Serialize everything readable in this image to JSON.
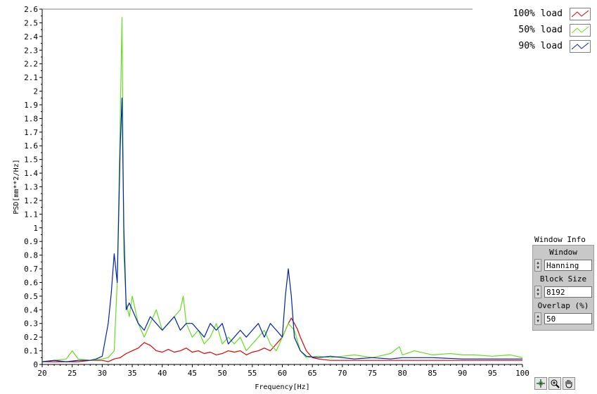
{
  "chart_data": {
    "type": "line",
    "xlabel": "Frequency[Hz]",
    "ylabel": "PSD[mm**2/Hz]",
    "xlim": [
      20,
      100
    ],
    "ylim": [
      0,
      2.6
    ],
    "x_ticks": [
      20,
      25,
      30,
      35,
      40,
      45,
      50,
      55,
      60,
      65,
      70,
      75,
      80,
      85,
      90,
      95,
      100
    ],
    "y_ticks": [
      0,
      0.1,
      0.2,
      0.3,
      0.4,
      0.5,
      0.6,
      0.7,
      0.8,
      0.9,
      1,
      1.1,
      1.2,
      1.3,
      1.4,
      1.5,
      1.6,
      1.7,
      1.8,
      1.9,
      2,
      2.1,
      2.2,
      2.3,
      2.4,
      2.5,
      2.6
    ],
    "grid": false,
    "legend_position": "top-right",
    "series": [
      {
        "name": "100% load",
        "color": "#e00000",
        "x": [
          20,
          22,
          24,
          26,
          28,
          30,
          31,
          32,
          33,
          34,
          35,
          36,
          37,
          38,
          39,
          40,
          41,
          42,
          43,
          44,
          45,
          46,
          47,
          48,
          49,
          50,
          51,
          52,
          53,
          54,
          55,
          56,
          57,
          58,
          59,
          60,
          61,
          61.5,
          62,
          62.5,
          63,
          64,
          65,
          66,
          68,
          70,
          72,
          75,
          78,
          80,
          85,
          90,
          95,
          100
        ],
        "y": [
          0.02,
          0.02,
          0.02,
          0.02,
          0.03,
          0.03,
          0.02,
          0.04,
          0.05,
          0.08,
          0.1,
          0.12,
          0.16,
          0.14,
          0.1,
          0.09,
          0.11,
          0.09,
          0.1,
          0.12,
          0.09,
          0.1,
          0.08,
          0.09,
          0.07,
          0.08,
          0.1,
          0.09,
          0.1,
          0.07,
          0.09,
          0.1,
          0.12,
          0.1,
          0.15,
          0.2,
          0.3,
          0.34,
          0.3,
          0.26,
          0.2,
          0.1,
          0.05,
          0.04,
          0.03,
          0.03,
          0.03,
          0.03,
          0.03,
          0.03,
          0.03,
          0.03,
          0.03,
          0.03
        ]
      },
      {
        "name": "50% load",
        "color": "#66dd22",
        "x": [
          20,
          22,
          24,
          25,
          26,
          28,
          30,
          31,
          32,
          32.5,
          33,
          33.3,
          33.6,
          34,
          34.5,
          35,
          36,
          37,
          38,
          39,
          40,
          41,
          42,
          43,
          43.5,
          44,
          45,
          46,
          47,
          48,
          49,
          50,
          51,
          52,
          53,
          54,
          55,
          56,
          57,
          58,
          59,
          60,
          61,
          62,
          63,
          64,
          66,
          68,
          70,
          72,
          75,
          78,
          79.5,
          80,
          82,
          85,
          88,
          90,
          92,
          95,
          98,
          100
        ],
        "y": [
          0.02,
          0.03,
          0.04,
          0.1,
          0.04,
          0.03,
          0.04,
          0.05,
          0.1,
          0.6,
          1.8,
          2.54,
          0.8,
          0.45,
          0.35,
          0.5,
          0.3,
          0.2,
          0.3,
          0.4,
          0.25,
          0.3,
          0.35,
          0.4,
          0.5,
          0.3,
          0.2,
          0.25,
          0.15,
          0.2,
          0.3,
          0.15,
          0.2,
          0.15,
          0.2,
          0.1,
          0.15,
          0.2,
          0.25,
          0.15,
          0.1,
          0.2,
          0.3,
          0.25,
          0.1,
          0.05,
          0.06,
          0.05,
          0.06,
          0.07,
          0.05,
          0.08,
          0.13,
          0.07,
          0.1,
          0.07,
          0.08,
          0.07,
          0.07,
          0.06,
          0.07,
          0.05
        ]
      },
      {
        "name": "90% load",
        "color": "#0022aa",
        "x": [
          20,
          22,
          24,
          26,
          28,
          29,
          30,
          31,
          31.5,
          32,
          32.5,
          33,
          33.3,
          33.6,
          34,
          34.5,
          35,
          36,
          37,
          38,
          39,
          40,
          41,
          42,
          43,
          44,
          45,
          46,
          47,
          48,
          49,
          50,
          51,
          52,
          53,
          54,
          55,
          56,
          57,
          58,
          59,
          60,
          60.5,
          61,
          61.5,
          62,
          63,
          64,
          66,
          68,
          70,
          72,
          75,
          78,
          80,
          85,
          90,
          95,
          100
        ],
        "y": [
          0.02,
          0.03,
          0.02,
          0.03,
          0.03,
          0.04,
          0.06,
          0.3,
          0.52,
          0.81,
          0.6,
          1.6,
          1.95,
          1.0,
          0.4,
          0.45,
          0.4,
          0.3,
          0.25,
          0.35,
          0.3,
          0.25,
          0.3,
          0.35,
          0.25,
          0.3,
          0.3,
          0.25,
          0.2,
          0.3,
          0.25,
          0.3,
          0.15,
          0.2,
          0.25,
          0.2,
          0.25,
          0.3,
          0.2,
          0.3,
          0.25,
          0.2,
          0.5,
          0.7,
          0.5,
          0.2,
          0.1,
          0.06,
          0.05,
          0.06,
          0.05,
          0.04,
          0.05,
          0.04,
          0.05,
          0.05,
          0.04,
          0.04,
          0.04
        ]
      }
    ]
  },
  "window_info": {
    "title": "Window Info",
    "window_label": "Window",
    "window_value": "Hanning",
    "block_size_label": "Block Size",
    "block_size_value": "8192",
    "overlap_label": "Overlap (%)",
    "overlap_value": "50"
  },
  "tools": {
    "icons": [
      "crosshair-icon",
      "zoom-icon",
      "pan-hand-icon"
    ]
  }
}
